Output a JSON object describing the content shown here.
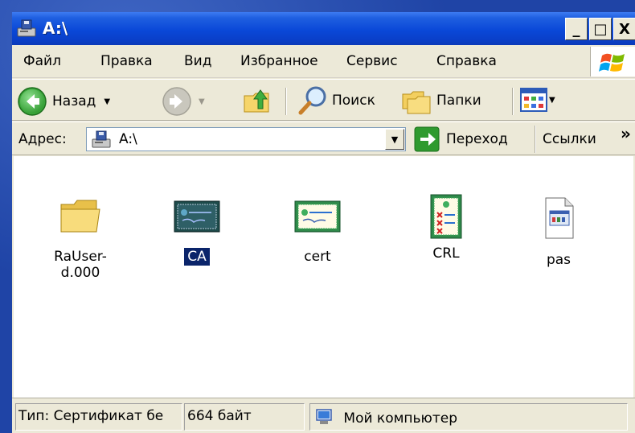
{
  "window": {
    "title": "A:\\"
  },
  "titlebar": {
    "minimize": "_",
    "maximize": "□",
    "close": "X"
  },
  "menu": [
    {
      "label": "Файл"
    },
    {
      "label": "Правка"
    },
    {
      "label": "Вид"
    },
    {
      "label": "Избранное"
    },
    {
      "label": "Сервис"
    },
    {
      "label": "Справка"
    }
  ],
  "toolbar": {
    "back_label": "Назад",
    "search_label": "Поиск",
    "folders_label": "Папки"
  },
  "address": {
    "label": "Адрес:",
    "value": "A:\\",
    "go_label": "Переход",
    "links_label": "Ссылки",
    "more": "»"
  },
  "files": [
    {
      "name": "RaUser-d.000",
      "icon": "folder-icon"
    },
    {
      "name": "CA",
      "icon": "certificate-icon",
      "selected": true
    },
    {
      "name": "cert",
      "icon": "certificate-icon"
    },
    {
      "name": "CRL",
      "icon": "crl-icon"
    },
    {
      "name": "pas",
      "icon": "document-icon"
    }
  ],
  "status": {
    "type": "Тип: Сертификат бе",
    "size": "664 байт",
    "location": "Мой компьютер"
  },
  "colors": {
    "titlebar": "#0a48d8",
    "selection": "#0a246a",
    "chrome": "#ece9d8"
  }
}
